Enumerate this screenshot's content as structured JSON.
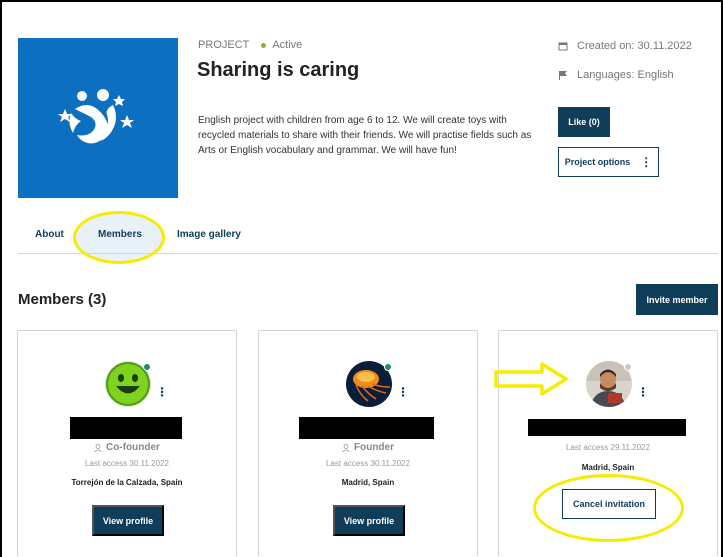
{
  "project": {
    "type_label": "PROJECT",
    "status": "Active",
    "title": "Sharing is caring",
    "description": "English project with children from age 6 to 12. We will create toys with recycled materials to share with their friends. We will practise fields such as Arts or English vocabulary and grammar. We will have fun!",
    "created": "Created on: 30.11.2022",
    "languages": "Languages: English",
    "like_label": "Like (0)",
    "options_label": "Project options"
  },
  "tabs": [
    {
      "label": "About"
    },
    {
      "label": "Members",
      "selected": true
    },
    {
      "label": "Image gallery"
    }
  ],
  "members": {
    "heading": "Members (3)",
    "invite_label": "Invite member",
    "cards": [
      {
        "role": "Co-founder",
        "last_access": "Last access 30.11.2022",
        "location": "Torrejón de la Calzada, Spain",
        "action": "View profile",
        "status": "online"
      },
      {
        "role": "Founder",
        "last_access": "Last access 30.11.2022",
        "location": "Madrid, Spain",
        "action": "View profile",
        "status": "online"
      },
      {
        "role": "",
        "last_access": "Last access 29.11.2022",
        "location": "Madrid, Spain",
        "action": "Cancel invitation",
        "status": "offline"
      }
    ]
  },
  "icons": {
    "calendar": "calendar-icon",
    "flag": "flag-icon",
    "user": "user-icon",
    "kebab": "kebab-menu-icon"
  },
  "colors": {
    "primary": "#0f3d5a",
    "logo_bg": "#0c6fbf",
    "active": "#8ab52a",
    "online": "#1a8a7a",
    "highlight": "#f5ec00"
  }
}
